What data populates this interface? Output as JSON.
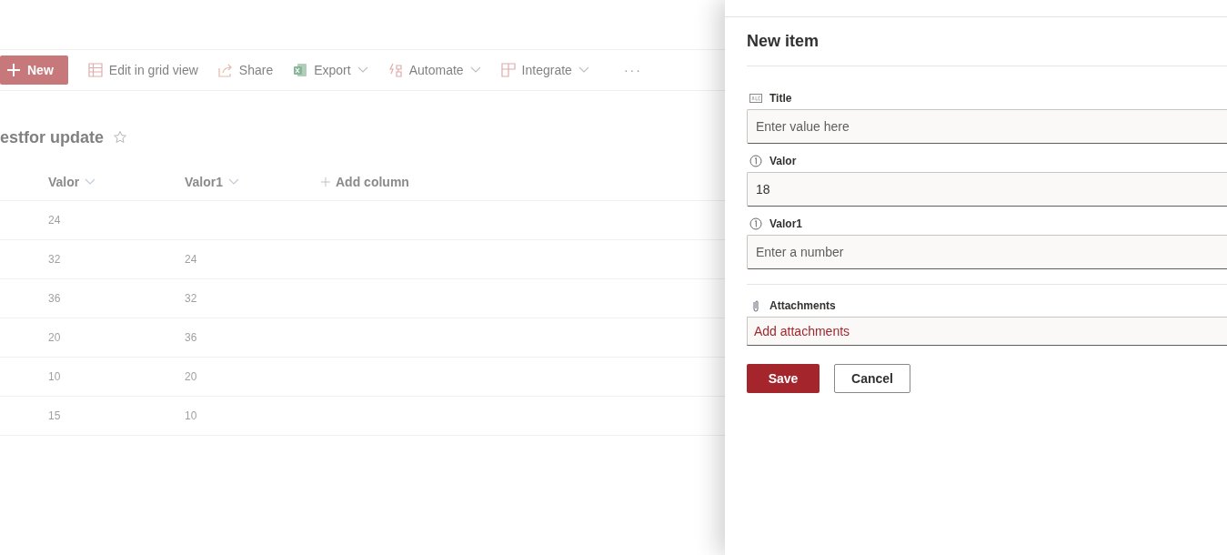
{
  "toolbar": [
    {
      "kind": "new",
      "label": "New"
    },
    {
      "kind": "grid",
      "label": "Edit in grid view",
      "dropdown": false
    },
    {
      "kind": "share",
      "label": "Share",
      "dropdown": false
    },
    {
      "kind": "excel",
      "label": "Export",
      "dropdown": true
    },
    {
      "kind": "automate",
      "label": "Automate",
      "dropdown": true
    },
    {
      "kind": "integrate",
      "label": "Integrate",
      "dropdown": true
    },
    {
      "kind": "more",
      "label": "···"
    }
  ],
  "list_title": "estfor update",
  "columns": [
    {
      "label": "Valor",
      "sortable": true
    },
    {
      "label": "Valor1",
      "sortable": true
    },
    {
      "label": "Add column",
      "sortable": false
    }
  ],
  "rows": [
    [
      "24",
      ""
    ],
    [
      "32",
      "24"
    ],
    [
      "36",
      "32"
    ],
    [
      "20",
      "36"
    ],
    [
      "10",
      "20"
    ],
    [
      "15",
      "10"
    ]
  ],
  "panel": {
    "title": "New item",
    "fields": [
      {
        "kind": "text",
        "label": "Title",
        "placeholder": "Enter value here"
      },
      {
        "kind": "number",
        "label": "Valor",
        "value": "18"
      },
      {
        "kind": "number",
        "label": "Valor1",
        "placeholder": "Enter a number"
      }
    ],
    "attachments": {
      "label": "Attachments",
      "link": "Add attachments"
    },
    "buttons": [
      "Save",
      "Cancel"
    ]
  }
}
